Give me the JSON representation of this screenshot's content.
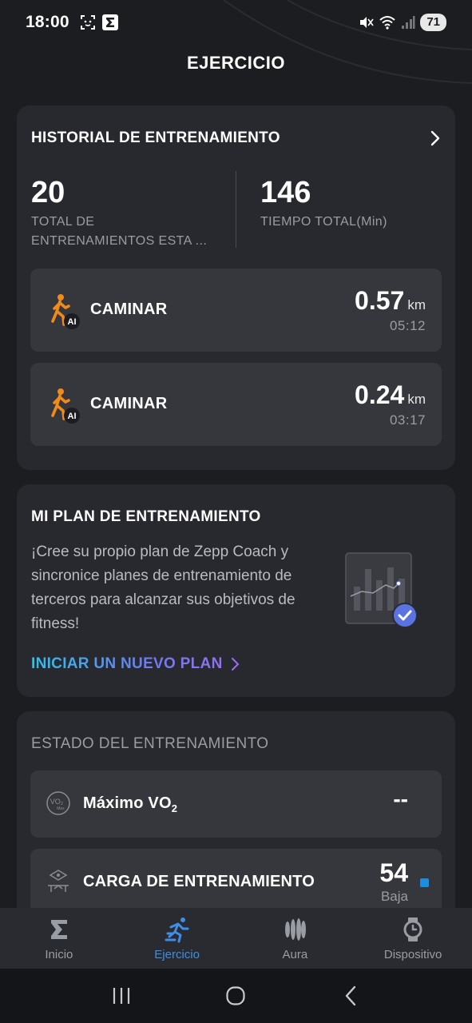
{
  "status_bar": {
    "time": "18:00",
    "battery": "71",
    "icons": [
      "screenshot-icon",
      "zepp-icon",
      "mute-icon",
      "wifi-icon",
      "signal-icon"
    ]
  },
  "header": {
    "title": "EJERCICIO"
  },
  "history": {
    "title": "HISTORIAL DE ENTRENAMIENTO",
    "total_workouts_value": "20",
    "total_workouts_label_line1": "TOTAL DE",
    "total_workouts_label_line2": "ENTRENAMIENTOS ESTA ...",
    "total_time_value": "146",
    "total_time_label": "TIEMPO TOTAL(Min)",
    "workouts": [
      {
        "name": "CAMINAR",
        "distance": "0.57",
        "unit": "km",
        "duration": "05:12",
        "badge": "AI"
      },
      {
        "name": "CAMINAR",
        "distance": "0.24",
        "unit": "km",
        "duration": "03:17",
        "badge": "AI"
      }
    ]
  },
  "plan": {
    "title": "MI PLAN DE ENTRENAMIENTO",
    "description": "¡Cree su propio plan de Zepp Coach y sincronice planes de entrenamiento de terceros para alcanzar sus objetivos de fitness!",
    "link_label": "INICIAR UN NUEVO PLAN"
  },
  "training_status": {
    "title": "ESTADO DEL ENTRENAMIENTO",
    "vo2_label": "Máximo VO",
    "vo2_sub": "2",
    "vo2_value": "--",
    "load_label": "CARGA DE ENTRENAMIENTO",
    "load_value": "54",
    "load_level": "Baja"
  },
  "nav": [
    {
      "label": "Inicio",
      "icon": "sigma-icon",
      "active": false
    },
    {
      "label": "Ejercicio",
      "icon": "running-icon",
      "active": true
    },
    {
      "label": "Aura",
      "icon": "aura-icon",
      "active": false
    },
    {
      "label": "Dispositivo",
      "icon": "watch-icon",
      "active": false
    }
  ],
  "colors": {
    "background": "#1c1d21",
    "card": "#28292e",
    "row": "#36373c",
    "accent_blue": "#3e8ee8",
    "walk_orange": "#f08a1c"
  }
}
